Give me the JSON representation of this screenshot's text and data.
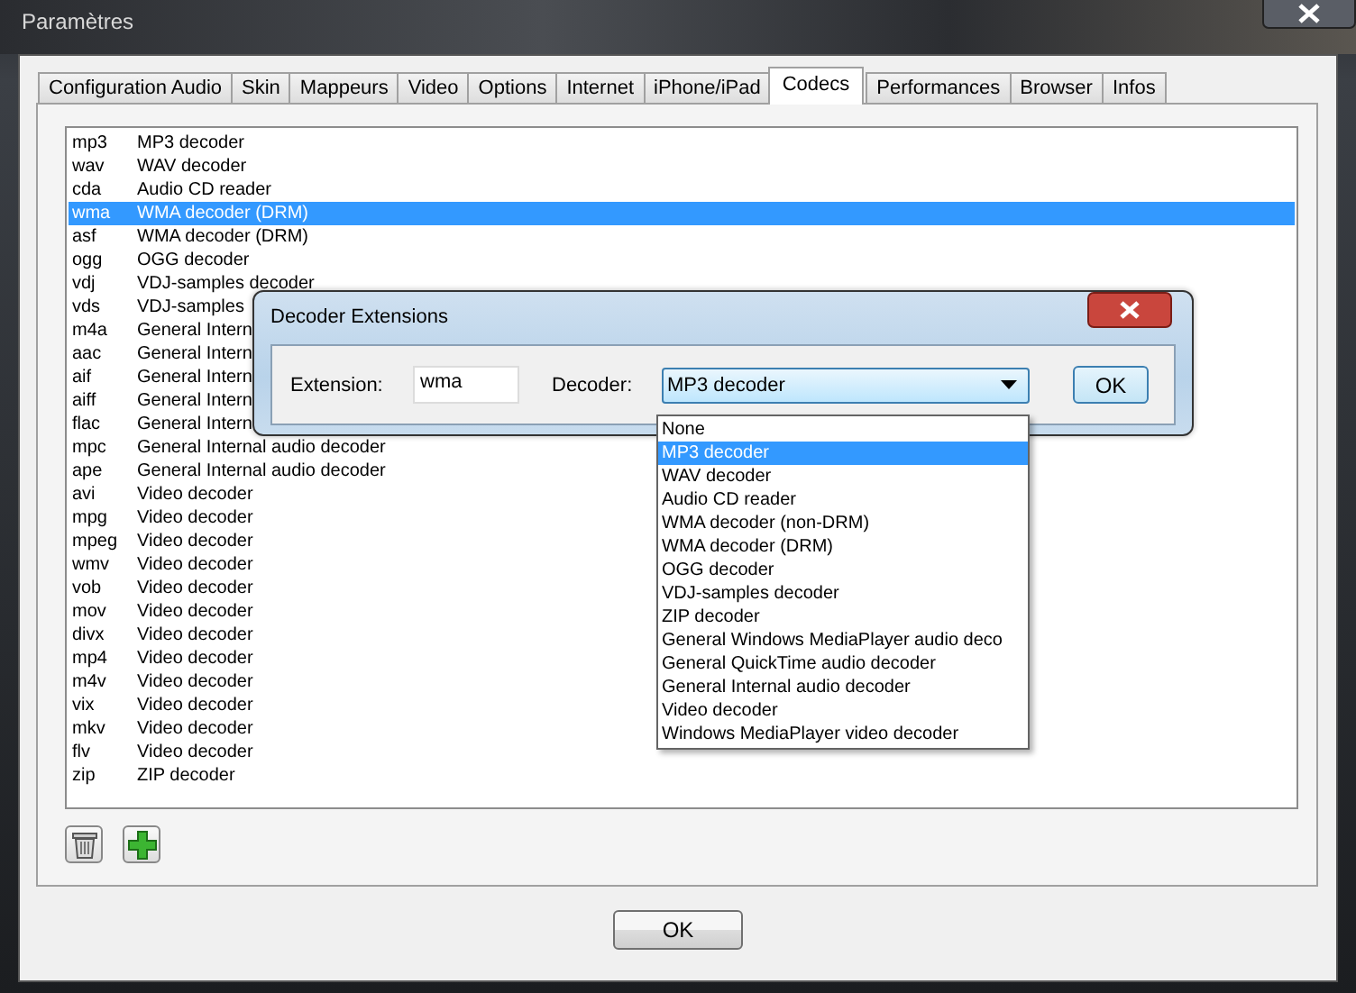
{
  "window": {
    "title": "Paramètres"
  },
  "tabs": [
    {
      "label": "Configuration Audio",
      "selected": false
    },
    {
      "label": "Skin",
      "selected": false
    },
    {
      "label": "Mappeurs",
      "selected": false
    },
    {
      "label": "Video",
      "selected": false
    },
    {
      "label": "Options",
      "selected": false
    },
    {
      "label": "Internet",
      "selected": false
    },
    {
      "label": "iPhone/iPad",
      "selected": false
    },
    {
      "label": "Codecs",
      "selected": true
    },
    {
      "label": "Performances",
      "selected": false
    },
    {
      "label": "Browser",
      "selected": false
    },
    {
      "label": "Infos",
      "selected": false
    }
  ],
  "codecs": [
    {
      "extension": "mp3",
      "decoder": "MP3 decoder",
      "selected": false
    },
    {
      "extension": "wav",
      "decoder": "WAV decoder",
      "selected": false
    },
    {
      "extension": "cda",
      "decoder": "Audio CD reader",
      "selected": false
    },
    {
      "extension": "wma",
      "decoder": "WMA decoder (DRM)",
      "selected": true
    },
    {
      "extension": "asf",
      "decoder": "WMA decoder (DRM)",
      "selected": false
    },
    {
      "extension": "ogg",
      "decoder": "OGG decoder",
      "selected": false
    },
    {
      "extension": "vdj",
      "decoder": "VDJ-samples decoder",
      "selected": false
    },
    {
      "extension": "vds",
      "decoder": "VDJ-samples",
      "selected": false
    },
    {
      "extension": "m4a",
      "decoder": "General Intern",
      "selected": false
    },
    {
      "extension": "aac",
      "decoder": "General Intern",
      "selected": false
    },
    {
      "extension": "aif",
      "decoder": "General Intern",
      "selected": false
    },
    {
      "extension": "aiff",
      "decoder": "General Intern",
      "selected": false
    },
    {
      "extension": "flac",
      "decoder": "General Intern",
      "selected": false
    },
    {
      "extension": "mpc",
      "decoder": "General Internal audio decoder",
      "selected": false
    },
    {
      "extension": "ape",
      "decoder": "General Internal audio decoder",
      "selected": false
    },
    {
      "extension": "avi",
      "decoder": "Video decoder",
      "selected": false
    },
    {
      "extension": "mpg",
      "decoder": "Video decoder",
      "selected": false
    },
    {
      "extension": "mpeg",
      "decoder": "Video decoder",
      "selected": false
    },
    {
      "extension": "wmv",
      "decoder": "Video decoder",
      "selected": false
    },
    {
      "extension": "vob",
      "decoder": "Video decoder",
      "selected": false
    },
    {
      "extension": "mov",
      "decoder": "Video decoder",
      "selected": false
    },
    {
      "extension": "divx",
      "decoder": "Video decoder",
      "selected": false
    },
    {
      "extension": "mp4",
      "decoder": "Video decoder",
      "selected": false
    },
    {
      "extension": "m4v",
      "decoder": "Video decoder",
      "selected": false
    },
    {
      "extension": "vix",
      "decoder": "Video decoder",
      "selected": false
    },
    {
      "extension": "mkv",
      "decoder": "Video decoder",
      "selected": false
    },
    {
      "extension": "flv",
      "decoder": "Video decoder",
      "selected": false
    },
    {
      "extension": "zip",
      "decoder": "ZIP decoder",
      "selected": false
    }
  ],
  "ok_button": "OK",
  "dialog": {
    "title": "Decoder Extensions",
    "extension_label": "Extension:",
    "extension_value": "wma",
    "decoder_label": "Decoder:",
    "decoder_value": "MP3 decoder",
    "ok_button": "OK",
    "options": [
      {
        "label": "None",
        "selected": false
      },
      {
        "label": "MP3 decoder",
        "selected": true
      },
      {
        "label": "WAV decoder",
        "selected": false
      },
      {
        "label": "Audio CD reader",
        "selected": false
      },
      {
        "label": "WMA decoder (non-DRM)",
        "selected": false
      },
      {
        "label": "WMA decoder (DRM)",
        "selected": false
      },
      {
        "label": "OGG decoder",
        "selected": false
      },
      {
        "label": "VDJ-samples decoder",
        "selected": false
      },
      {
        "label": "ZIP decoder",
        "selected": false
      },
      {
        "label": "General Windows MediaPlayer audio deco",
        "selected": false
      },
      {
        "label": "General QuickTime audio decoder",
        "selected": false
      },
      {
        "label": "General Internal audio decoder",
        "selected": false
      },
      {
        "label": "Video decoder",
        "selected": false
      },
      {
        "label": "Windows MediaPlayer video decoder",
        "selected": false
      }
    ]
  }
}
